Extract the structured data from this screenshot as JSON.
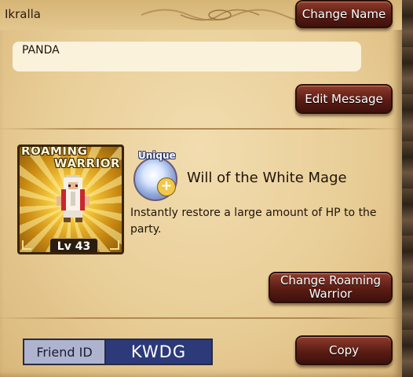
{
  "profile": {
    "player_name": "Ikralla",
    "message": "PANDA"
  },
  "buttons": {
    "change_name": "Change Name",
    "edit_message": "Edit Message",
    "change_roaming_warrior": "Change Roaming Warrior",
    "copy": "Copy"
  },
  "roaming_warrior": {
    "banner_line1": "ROAMING",
    "banner_line2": "WARRIOR",
    "level": "Lv 43",
    "sprite_icon": "white-mage-sprite-icon"
  },
  "ability": {
    "tag": "Unique",
    "name": "Will of the White Mage",
    "description": "Instantly restore a large amount of HP to the party.",
    "icon": "holy-orb-plus-icon"
  },
  "friend": {
    "label": "Friend ID",
    "value": "KWDG"
  },
  "colors": {
    "button_red": "#5a1c14",
    "panel_parchment": "#e8cd96",
    "friend_id_bg": "#2c3a7a",
    "friend_label_bg": "#aeb3cf"
  }
}
